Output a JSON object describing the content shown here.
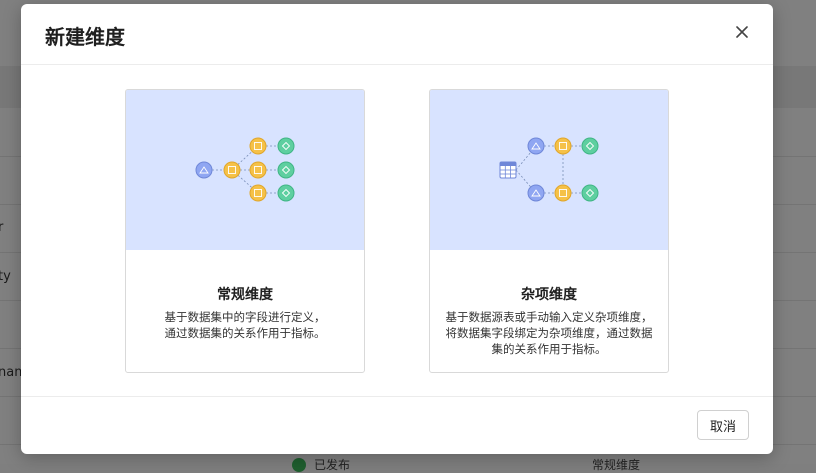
{
  "background": {
    "row_labels": [
      "r",
      "ty",
      "nam"
    ],
    "footer_texts": [
      "已发布",
      "常规维度"
    ]
  },
  "modal": {
    "title": "新建维度",
    "close_icon": "close-icon",
    "cards": [
      {
        "title": "常规维度",
        "description_lines": [
          "基于数据集中的字段进行定义，",
          "通过数据集的关系作用于指标。"
        ],
        "illustration": "dimension-flow-illustration"
      },
      {
        "title": "杂项维度",
        "description_lines": [
          "基于数据源表或手动输入定义杂项维度，",
          "将数据集字段绑定为杂项维度，通过数据",
          "集的关系作用于指标。"
        ],
        "illustration": "table-flow-illustration"
      }
    ],
    "cancel_label": "取消"
  },
  "colors": {
    "illustration_bg": "#d8e3ff",
    "node_blue": "#8fa6f2",
    "node_yellow": "#f5c148",
    "node_green": "#5ecfa0"
  }
}
